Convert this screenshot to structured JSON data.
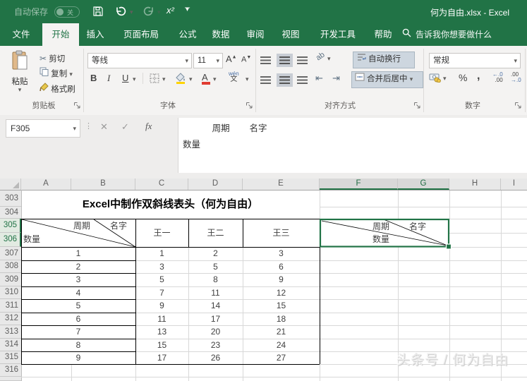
{
  "titlebar": {
    "autosave_label": "自动保存",
    "autosave_state": "关",
    "doc_title": "何为自由.xlsx - Excel",
    "superscript_label": "x²"
  },
  "tabs": {
    "file": "文件",
    "home": "开始",
    "insert": "插入",
    "page_layout": "页面布局",
    "formulas": "公式",
    "data": "数据",
    "review": "审阅",
    "view": "视图",
    "developer": "开发工具",
    "help": "帮助",
    "search_placeholder": "告诉我你想要做什么"
  },
  "ribbon": {
    "clipboard": {
      "group": "剪贴板",
      "paste": "粘贴",
      "cut": "剪切",
      "copy": "复制",
      "format_painter": "格式刷"
    },
    "font": {
      "group": "字体",
      "name": "等线",
      "size": "11",
      "bold": "B",
      "italic": "I",
      "underline": "U",
      "phonetic_top": "wén",
      "phonetic_bottom": "文"
    },
    "alignment": {
      "group": "对齐方式",
      "orientation": "ab",
      "wrap_text": "自动换行",
      "merge_center": "合并后居中"
    },
    "number": {
      "group": "数字",
      "format": "常规",
      "percent": "%",
      "comma": ",",
      "inc_top": "←.0",
      "inc_bottom": ".00",
      "dec_top": ".00",
      "dec_bottom": "→.0"
    }
  },
  "formula_bar": {
    "name_box": "F305",
    "cancel": "✕",
    "enter": "✓",
    "fx": "fx",
    "line1": "            周期        名字",
    "line2": "数量"
  },
  "sheet": {
    "col_headers": [
      "A",
      "B",
      "C",
      "D",
      "E",
      "F",
      "G",
      "H",
      "I"
    ],
    "row_headers": [
      "303",
      "304",
      "305",
      "306",
      "307",
      "308",
      "309",
      "310",
      "311",
      "312",
      "313",
      "314",
      "315",
      "316"
    ],
    "title": "Excel中制作双斜线表头（何为自由）",
    "diag_a": {
      "period": "周期",
      "name": "名字",
      "qty": "数量"
    },
    "diag_f": {
      "period": "周期",
      "name": "名字",
      "qty": "数量"
    },
    "col_titles": [
      "王一",
      "王二",
      "王三"
    ],
    "rows": [
      [
        "1",
        "1",
        "2",
        "3"
      ],
      [
        "2",
        "3",
        "5",
        "6"
      ],
      [
        "3",
        "5",
        "8",
        "9"
      ],
      [
        "4",
        "7",
        "11",
        "12"
      ],
      [
        "5",
        "9",
        "14",
        "15"
      ],
      [
        "6",
        "11",
        "17",
        "18"
      ],
      [
        "7",
        "13",
        "20",
        "21"
      ],
      [
        "8",
        "15",
        "23",
        "24"
      ],
      [
        "9",
        "17",
        "26",
        "27"
      ]
    ],
    "watermark": "头条号 / 何为自由"
  },
  "colors": {
    "excel_green": "#217346",
    "gridline": "#d8d8d8",
    "selection": "#217346"
  }
}
